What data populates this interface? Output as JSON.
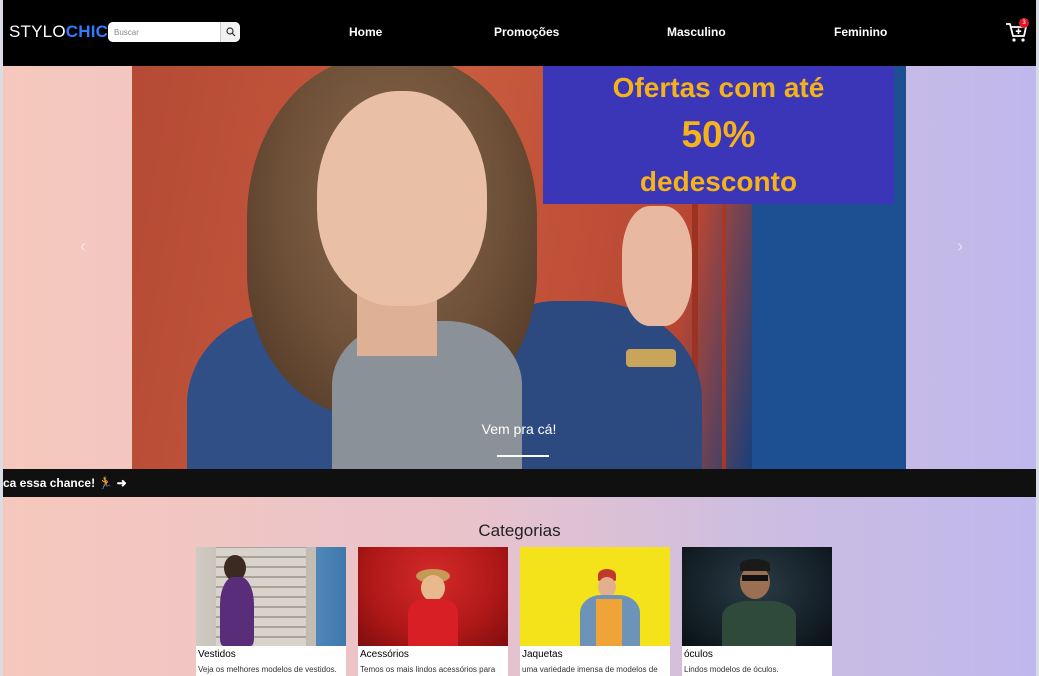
{
  "brand": {
    "part1": "STYLO",
    "part2": "CHIC"
  },
  "search": {
    "placeholder": "Buscar"
  },
  "nav": {
    "items": [
      "Home",
      "Promoções",
      "Masculino",
      "Feminino"
    ]
  },
  "cart": {
    "count": "3"
  },
  "hero": {
    "offer_line1": "Ofertas com até",
    "offer_line2": "50%",
    "offer_line3": "dedesconto",
    "caption": "Vem pra cá!"
  },
  "ticker": {
    "text": "ca essa chance! 🏃 ➜"
  },
  "categories": {
    "title": "Categorias",
    "items": [
      {
        "name": "Vestidos",
        "desc": "Veja os melhores modelos de vestidos."
      },
      {
        "name": "Acessórios",
        "desc": "Temos os mais lindos acessórios para"
      },
      {
        "name": "Jaquetas",
        "desc": "uma variedade imensa de modelos de"
      },
      {
        "name": "óculos",
        "desc": "Lindos modelos de óculos."
      }
    ]
  },
  "colors": {
    "accent": "#2f7cff",
    "offer_bg": "#3b35b8",
    "offer_text": "#f4b21b",
    "badge": "#e0162b"
  }
}
